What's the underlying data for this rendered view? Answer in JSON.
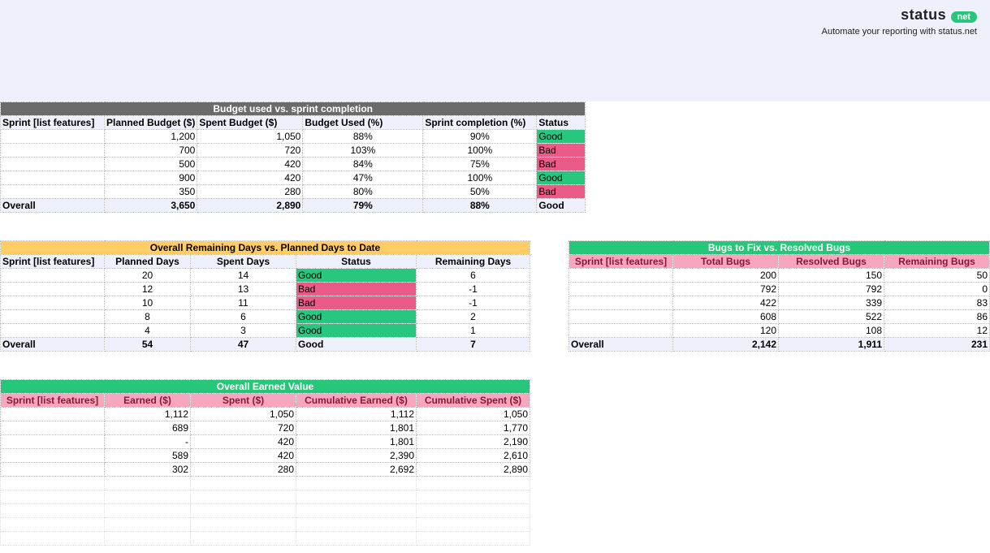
{
  "branding": {
    "name": "status",
    "pill": "net",
    "tagline": "Automate your reporting with status.net"
  },
  "budget": {
    "title": "Budget used vs. sprint completion",
    "headers": [
      "Sprint [list features]",
      "Planned Budget ($)",
      "Spent Budget ($)",
      "Budget Used (%)",
      "Sprint completion (%)",
      "Status"
    ],
    "rows": [
      {
        "sprint": "",
        "planned": "1,200",
        "spent": "1,050",
        "used": "88%",
        "completion": "90%",
        "status": "Good"
      },
      {
        "sprint": "",
        "planned": "700",
        "spent": "720",
        "used": "103%",
        "completion": "100%",
        "status": "Bad"
      },
      {
        "sprint": "",
        "planned": "500",
        "spent": "420",
        "used": "84%",
        "completion": "75%",
        "status": "Bad"
      },
      {
        "sprint": "",
        "planned": "900",
        "spent": "420",
        "used": "47%",
        "completion": "100%",
        "status": "Good"
      },
      {
        "sprint": "",
        "planned": "350",
        "spent": "280",
        "used": "80%",
        "completion": "50%",
        "status": "Bad"
      }
    ],
    "overall": {
      "label": "Overall",
      "planned": "3,650",
      "spent": "2,890",
      "used": "79%",
      "completion": "88%",
      "status": "Good"
    }
  },
  "days": {
    "title": "Overall Remaining Days vs. Planned Days to Date",
    "headers": [
      "Sprint [list features]",
      "Planned Days",
      "Spent Days",
      "Status",
      "Remaining Days"
    ],
    "rows": [
      {
        "sprint": "",
        "planned": "20",
        "spent": "14",
        "status": "Good",
        "remaining": "6"
      },
      {
        "sprint": "",
        "planned": "12",
        "spent": "13",
        "status": "Bad",
        "remaining": "-1"
      },
      {
        "sprint": "",
        "planned": "10",
        "spent": "11",
        "status": "Bad",
        "remaining": "-1"
      },
      {
        "sprint": "",
        "planned": "8",
        "spent": "6",
        "status": "Good",
        "remaining": "2"
      },
      {
        "sprint": "",
        "planned": "4",
        "spent": "3",
        "status": "Good",
        "remaining": "1"
      }
    ],
    "overall": {
      "label": "Overall",
      "planned": "54",
      "spent": "47",
      "status": "Good",
      "remaining": "7"
    }
  },
  "bugs": {
    "title": "Bugs to Fix vs. Resolved Bugs",
    "headers": [
      "Sprint [list features]",
      "Total Bugs",
      "Resolved Bugs",
      "Remaining Bugs"
    ],
    "rows": [
      {
        "sprint": "",
        "total": "200",
        "resolved": "150",
        "remaining": "50"
      },
      {
        "sprint": "",
        "total": "792",
        "resolved": "792",
        "remaining": "0"
      },
      {
        "sprint": "",
        "total": "422",
        "resolved": "339",
        "remaining": "83"
      },
      {
        "sprint": "",
        "total": "608",
        "resolved": "522",
        "remaining": "86"
      },
      {
        "sprint": "",
        "total": "120",
        "resolved": "108",
        "remaining": "12"
      }
    ],
    "overall": {
      "label": "Overall",
      "total": "2,142",
      "resolved": "1,911",
      "remaining": "231"
    }
  },
  "earned": {
    "title": "Overall Earned Value",
    "headers": [
      "Sprint [list features]",
      "Earned ($)",
      "Spent ($)",
      "Cumulative Earned ($)",
      "Cumulative Spent ($)"
    ],
    "rows": [
      {
        "sprint": "",
        "earned": "1,112",
        "spent": "1,050",
        "cearned": "1,112",
        "cspent": "1,050"
      },
      {
        "sprint": "",
        "earned": "689",
        "spent": "720",
        "cearned": "1,801",
        "cspent": "1,770"
      },
      {
        "sprint": "",
        "earned": "-",
        "spent": "420",
        "cearned": "1,801",
        "cspent": "2,190"
      },
      {
        "sprint": "",
        "earned": "589",
        "spent": "420",
        "cearned": "2,390",
        "cspent": "2,610"
      },
      {
        "sprint": "",
        "earned": "302",
        "spent": "280",
        "cearned": "2,692",
        "cspent": "2,890"
      }
    ]
  }
}
